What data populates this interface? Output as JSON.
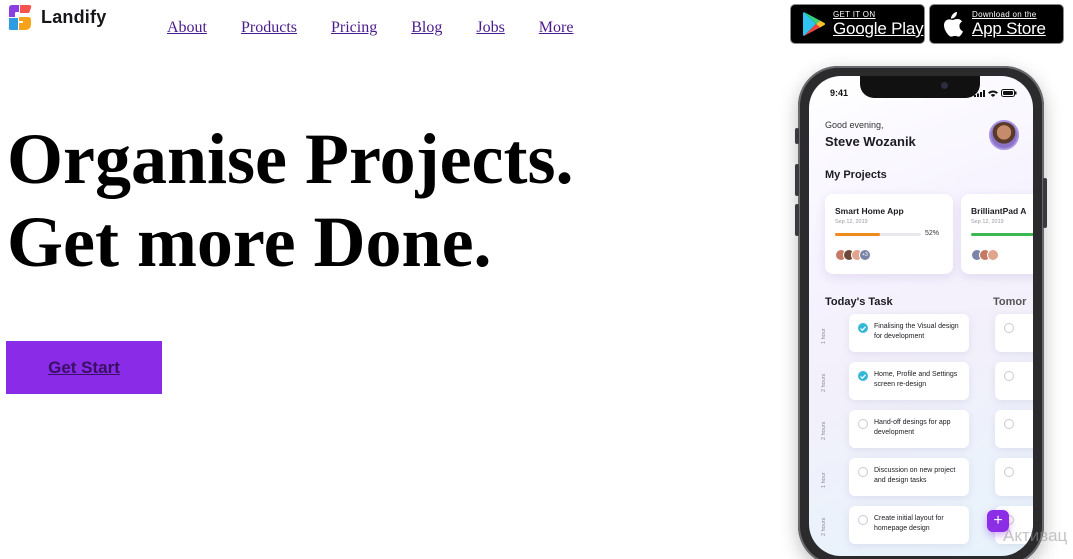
{
  "brand": {
    "name": "Landify"
  },
  "nav": {
    "items": [
      {
        "label": "About"
      },
      {
        "label": "Products"
      },
      {
        "label": "Pricing"
      },
      {
        "label": "Blog"
      },
      {
        "label": "Jobs"
      },
      {
        "label": "More"
      }
    ]
  },
  "stores": {
    "google": {
      "small": "GET IT ON",
      "big": "Google Play",
      "icon": "google-play-icon"
    },
    "apple": {
      "small": "Download on the",
      "big": "App Store",
      "icon": "apple-icon"
    }
  },
  "hero": {
    "line1": "Organise Projects.",
    "line2": "Get more Done.",
    "cta_label": "Get Start"
  },
  "phone_app": {
    "status_time": "9:41",
    "greeting": "Good evening,",
    "user_name": "Steve Wozanik",
    "my_projects_heading": "My Projects",
    "projects": [
      {
        "title": "Smart Home App",
        "date": "Sep 12, 2019",
        "progress_percent": 52,
        "progress_label": "52%",
        "progress_color": "#f0891e",
        "extra_members": "+3"
      },
      {
        "title": "BrilliantPad A",
        "date": "Sep 12, 2019",
        "progress_color": "#3cb853"
      }
    ],
    "today_heading": "Today's Task",
    "tomorrow_heading": "Tomor",
    "tasks": [
      {
        "hours": "1 hour",
        "text": "Finalising the Visual design for development",
        "done": true
      },
      {
        "hours": "2 hours",
        "text": "Home, Profile and Settings screen re-design",
        "done": true
      },
      {
        "hours": "2 hours",
        "text": "Hand-off desings for app development",
        "done": false
      },
      {
        "hours": "1 hour",
        "text": "Discussion on new project and design tasks",
        "done": false
      },
      {
        "hours": "2 hours",
        "text": "Create initial layout for homepage design",
        "done": false
      }
    ],
    "fab_label": "+"
  },
  "watermark": {
    "text": "Активац"
  },
  "colors": {
    "accent": "#8a2be8",
    "nav_link": "#4b1b8d"
  }
}
